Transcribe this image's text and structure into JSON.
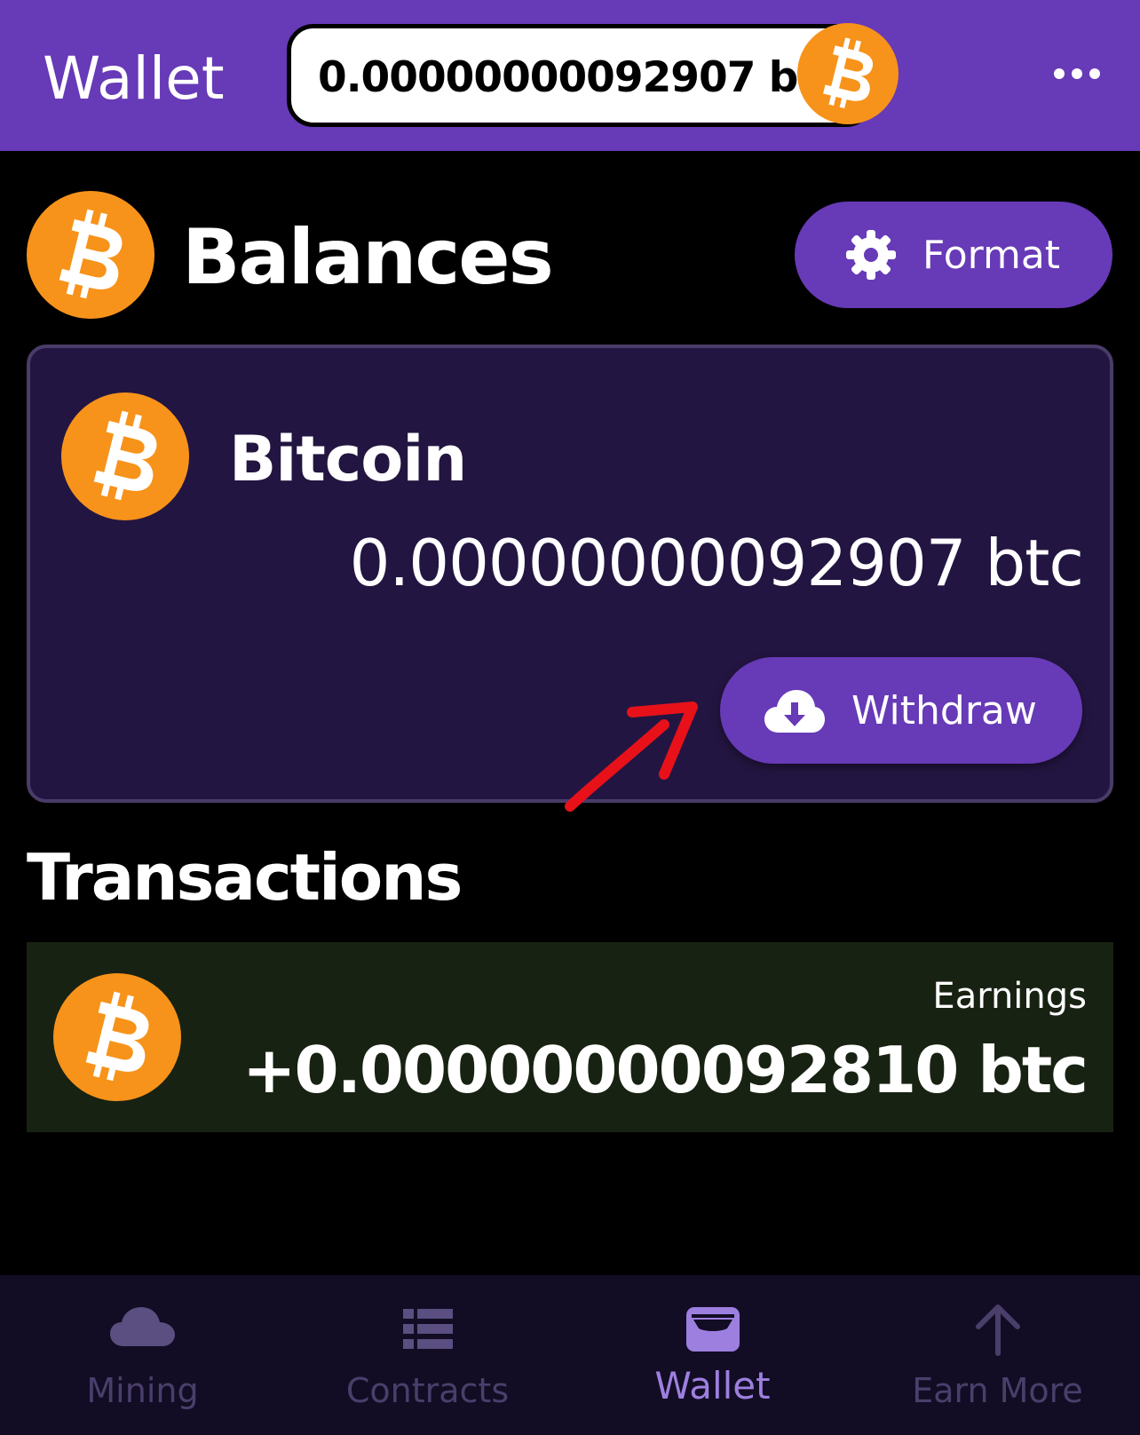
{
  "header": {
    "title": "Wallet",
    "balance": "0.00000000092907 btc",
    "coin_icon": "bitcoin-icon",
    "more_icon": "more-horizontal-icon"
  },
  "balances": {
    "title": "Balances",
    "format_button": "Format",
    "format_icon": "gear-icon"
  },
  "card": {
    "name": "Bitcoin",
    "amount": "0.00000000092907 btc",
    "withdraw_button": "Withdraw",
    "withdraw_icon": "cloud-download-icon"
  },
  "transactions": {
    "title": "Transactions",
    "items": [
      {
        "type": "Earnings",
        "amount": "+0.00000000092810 btc",
        "icon": "bitcoin-icon"
      }
    ]
  },
  "bottom_nav": {
    "items": [
      {
        "label": "Mining",
        "icon": "cloud-icon",
        "active": false
      },
      {
        "label": "Contracts",
        "icon": "list-icon",
        "active": false
      },
      {
        "label": "Wallet",
        "icon": "wallet-icon",
        "active": true
      },
      {
        "label": "Earn More",
        "icon": "arrow-up-icon",
        "active": false
      }
    ]
  },
  "colors": {
    "primary": "#673ab7",
    "bitcoin": "#f7931a",
    "card_bg": "#231541",
    "tx_bg": "#182212",
    "nav_bg": "#120d24"
  }
}
